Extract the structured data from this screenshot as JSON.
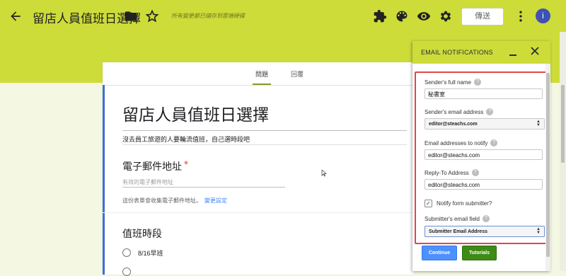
{
  "header": {
    "form_title": "留店人員值班日選擇",
    "saved_note": "所有變更都已儲存到雲端硬碟",
    "send_label": "傳送",
    "avatar_initial": "i",
    "icons": [
      "back-arrow-icon",
      "folder-icon",
      "star-icon",
      "puzzle-addon-icon",
      "palette-icon",
      "eye-preview-icon",
      "gear-icon",
      "more-vert-icon"
    ],
    "accent_color": "#cddc39"
  },
  "tabs": [
    {
      "label": "問題",
      "active": true
    },
    {
      "label": "回覆",
      "active": false
    }
  ],
  "form": {
    "title": "留店人員值班日選擇",
    "description": "沒去員工旅遊的人要輪流值班，自己選時段吧",
    "email_question": "電子郵件地址",
    "required_mark": "*",
    "email_placeholder": "有效的電子郵件地址",
    "collect_note": "這份表單會收集電子郵件地址。",
    "collect_link": "變更設定",
    "shift_question": "值班時段",
    "options": [
      "8/16早班"
    ]
  },
  "panel": {
    "title": "EMAIL NOTIFICATIONS",
    "sender_name_label": "Sender's full name",
    "sender_name_value": "秘書室",
    "sender_email_label": "Sender's email address",
    "sender_email_value": "editor@steachs.com",
    "notify_label": "Email addresses to notify",
    "notify_value": "editor@steachs.com",
    "reply_label": "Reply-To Address",
    "reply_value": "editor@steachs.com",
    "notify_submitter_label": "Notify form submitter?",
    "notify_submitter_checked": true,
    "submitter_field_label": "Submitter's email field",
    "submitter_field_value": "Submitter Email Address",
    "help_mark": "?",
    "continue_label": "Continue",
    "tutorials_label": "Tutorials",
    "highlight_color": "#e0474c"
  }
}
